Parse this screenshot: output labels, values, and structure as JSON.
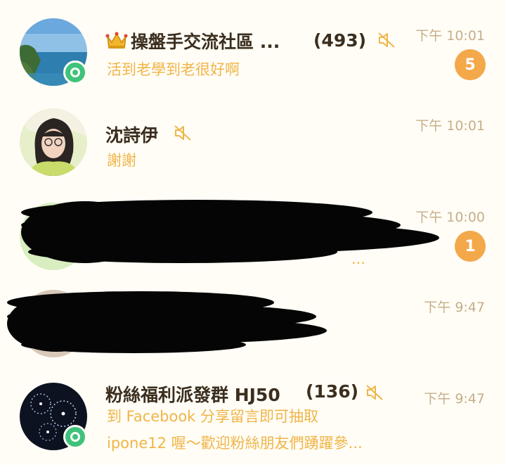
{
  "chats": [
    {
      "title": "操盤手交流社區 ...",
      "member_count": "(493)",
      "preview": "活到老學到老很好啊",
      "time": "下午 10:01",
      "unread": "5",
      "muted": true,
      "avatar_icon": "seaside-cliff-photo-icon"
    },
    {
      "title": "沈詩伊",
      "preview": "謝謝",
      "time": "下午 10:01",
      "muted": true,
      "avatar_icon": "person-portrait-photo-icon"
    },
    {
      "preview_fragment": "...",
      "time": "下午 10:00",
      "unread": "1",
      "redacted": true
    },
    {
      "time": "下午 9:47",
      "redacted": true
    },
    {
      "title": "粉絲福利派發群 HJ50",
      "member_count": "(136)",
      "preview_line1": "到 Facebook 分享留言即可抽取",
      "preview_line2": "ipone12 喔～歡迎粉絲朋友們踴躍參...",
      "time": "下午 9:47",
      "muted": true,
      "avatar_icon": "night-lights-photo-icon"
    }
  ],
  "colors": {
    "background": "#fffdf6",
    "title": "#3b2e1e",
    "preview": "#f0b548",
    "time": "#c6ae8a",
    "unread_badge": "#f3a84a",
    "app_badge": "#3fc27a"
  }
}
